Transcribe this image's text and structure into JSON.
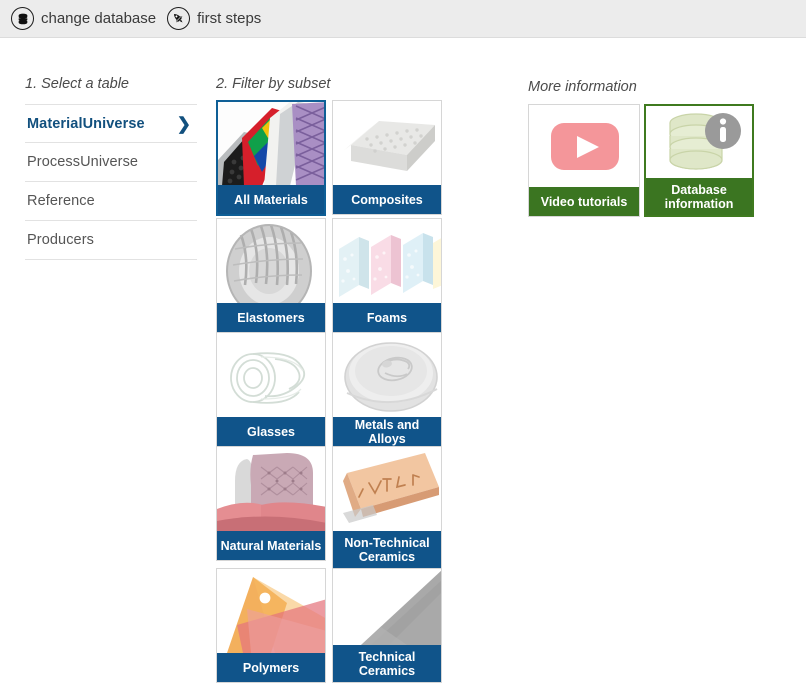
{
  "topbar": {
    "links": [
      {
        "id": "change-database",
        "label": "change database",
        "icon": "database-stack-icon"
      },
      {
        "id": "first-steps",
        "label": "first steps",
        "icon": "rocket-icon"
      }
    ]
  },
  "sections": {
    "select_table": "1. Select a table",
    "filter_subset": "2. Filter by subset",
    "more_information": "More information"
  },
  "table_list": {
    "items": [
      {
        "label": "MaterialUniverse",
        "selected": true,
        "chevron": "❯"
      },
      {
        "label": "ProcessUniverse",
        "selected": false
      },
      {
        "label": "Reference",
        "selected": false
      },
      {
        "label": "Producers",
        "selected": false
      }
    ]
  },
  "subset_tiles": [
    {
      "label": "All Materials",
      "selected": true,
      "art": "all-materials"
    },
    {
      "label": "Composites",
      "selected": false,
      "art": "composites"
    },
    {
      "label": "Elastomers",
      "selected": false,
      "art": "elastomers"
    },
    {
      "label": "Foams",
      "selected": false,
      "art": "foams"
    },
    {
      "label": "Glasses",
      "selected": false,
      "art": "glasses"
    },
    {
      "label": "Metals and Alloys",
      "selected": false,
      "art": "metals"
    },
    {
      "label": "Natural Materials",
      "selected": false,
      "art": "natural"
    },
    {
      "label": "Non-Technical Ceramics",
      "label_line1": "Non-Technical",
      "label_line2": "Ceramics",
      "selected": false,
      "art": "nontech-ceramics"
    },
    {
      "label": "Polymers",
      "selected": false,
      "art": "polymers"
    },
    {
      "label": "Technical Ceramics",
      "label_line1": "Technical",
      "label_line2": "Ceramics",
      "selected": false,
      "art": "tech-ceramics"
    }
  ],
  "info_tiles": [
    {
      "label": "Video tutorials",
      "selected": false,
      "art": "youtube-play-icon"
    },
    {
      "label": "Database information",
      "label_line1": "Database",
      "label_line2": "information",
      "selected": true,
      "art": "database-info-icon"
    }
  ],
  "colors": {
    "topbar_bg": "#ececec",
    "tile_caption_blue": "#10548a",
    "tile_caption_green": "#3b7521",
    "selected_blue_border": "#0f5f96",
    "selected_green_border": "#3f7a1f",
    "active_link_blue": "#12507e",
    "page_bg": "#ffffff"
  }
}
